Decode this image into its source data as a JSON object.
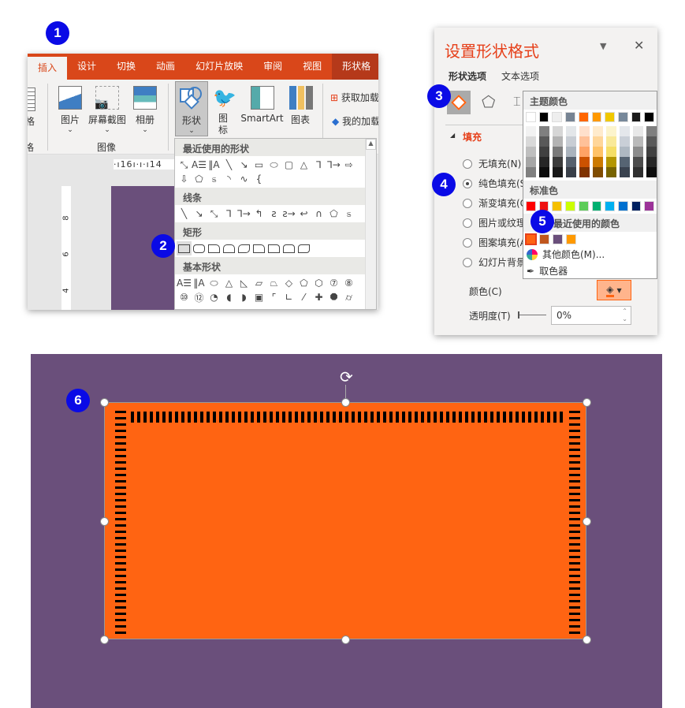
{
  "badges": [
    "1",
    "2",
    "3",
    "4",
    "5",
    "6"
  ],
  "ribbon": {
    "tabs": [
      {
        "label": "插入",
        "active": true
      },
      {
        "label": "设计"
      },
      {
        "label": "切换"
      },
      {
        "label": "动画"
      },
      {
        "label": "幻灯片放映"
      },
      {
        "label": "审阅"
      },
      {
        "label": "视图"
      },
      {
        "label": "形状格"
      }
    ],
    "partial_left": {
      "top": "格",
      "group": "格"
    },
    "buttons": {
      "picture": "图片",
      "screenshot": "屏幕截图",
      "album": "相册",
      "shapes": "形状",
      "icons": "图标",
      "smartart": "SmartArt",
      "chart": "图表",
      "get_addins": "获取加载",
      "my_addins": "我的加载"
    },
    "group_image": "图像",
    "ruler_h": [
      "16",
      "14"
    ],
    "ruler_v": [
      "8",
      "6",
      "4"
    ]
  },
  "shapes_menu": {
    "sections": [
      "最近使用的形状",
      "线条",
      "矩形",
      "基本形状"
    ],
    "recent": [
      "⤡",
      "A☰",
      "‖A",
      "╲",
      "↘",
      "▭",
      "⬭",
      "▢",
      "△",
      "⅂",
      "⅂→",
      "⇨",
      "⇩",
      "⬠",
      "ಽ",
      "◝",
      "∿",
      "{"
    ],
    "lines": [
      "╲",
      "↘",
      "⤡",
      "⅂",
      "⅂→",
      "↰",
      "ƨ",
      "ƨ→",
      "↩",
      "∩",
      "⬠",
      "ಽ"
    ],
    "basic": [
      "A☰",
      "‖A",
      "⬭",
      "△",
      "◺",
      "▱",
      "⏢",
      "◇",
      "⬠",
      "⬡",
      "⑦",
      "⑧",
      "⑩",
      "⑫",
      "◔",
      "◖",
      "◗",
      "▣",
      "⌜",
      "∟",
      "⁄",
      "✚",
      "⯃",
      "⌭"
    ]
  },
  "format_pane": {
    "title": "设置形状格式",
    "tabs": [
      "形状选项",
      "文本选项"
    ],
    "section": "填充",
    "options": [
      "无填充(N)",
      "纯色填充(S)",
      "渐变填充(G)",
      "图片或纹理填充",
      "图案填充(A)",
      "幻灯片背景填充"
    ],
    "selected_option": 1,
    "color_label": "颜色(C)",
    "transparency_label": "透明度(T)",
    "transparency_value": "0%",
    "accent": "#ff6412"
  },
  "color_popup": {
    "theme_label": "主题颜色",
    "theme_top": [
      "#ffffff",
      "#000000",
      "#eeeeee",
      "#768393",
      "#ff6600",
      "#ff9900",
      "#f0c800",
      "#77889a",
      "#1a1a1a",
      "#000000"
    ],
    "theme_shades": [
      [
        "#f2f2f2",
        "#d9d9d9",
        "#bfbfbf",
        "#a6a6a6",
        "#808080"
      ],
      [
        "#7f7f7f",
        "#595959",
        "#404040",
        "#262626",
        "#0d0d0d"
      ],
      [
        "#d6d6d6",
        "#b3b3b3",
        "#7a7a7a",
        "#3b3b3b",
        "#181818"
      ],
      [
        "#e3e6e9",
        "#c8cdd4",
        "#aab3bd",
        "#56606d",
        "#393f48"
      ],
      [
        "#ffe0cc",
        "#ffc199",
        "#ffa366",
        "#cc5200",
        "#803300"
      ],
      [
        "#ffebcc",
        "#ffd699",
        "#ffc266",
        "#cc7a00",
        "#804c00"
      ],
      [
        "#fcf4cc",
        "#f9e999",
        "#f5de66",
        "#b49600",
        "#786400"
      ],
      [
        "#e4e7eb",
        "#c9cfd7",
        "#aeb8c2",
        "#566473",
        "#3a4350"
      ],
      [
        "#e8e8e8",
        "#bababa",
        "#8c8c8c",
        "#4d4d4d",
        "#303030"
      ],
      [
        "#7f7f7f",
        "#595959",
        "#404040",
        "#262626",
        "#0d0d0d"
      ]
    ],
    "standard_label": "标准色",
    "standard": [
      "#ff0000",
      "#ee1111",
      "#f5c000",
      "#ccff00",
      "#5ecc5a",
      "#00b070",
      "#00b0f0",
      "#0070d0",
      "#002060",
      "#9c3399"
    ],
    "recent_label": "最近使用的颜色",
    "recent": [
      "#ff6412",
      "#c0561e",
      "#6a4f7b",
      "#ff9900"
    ],
    "more_colors": "其他颜色(M)...",
    "eyedropper": "取色器"
  },
  "slide": {
    "background": "#6a4f7b",
    "shape_fill": "#ff6412"
  }
}
